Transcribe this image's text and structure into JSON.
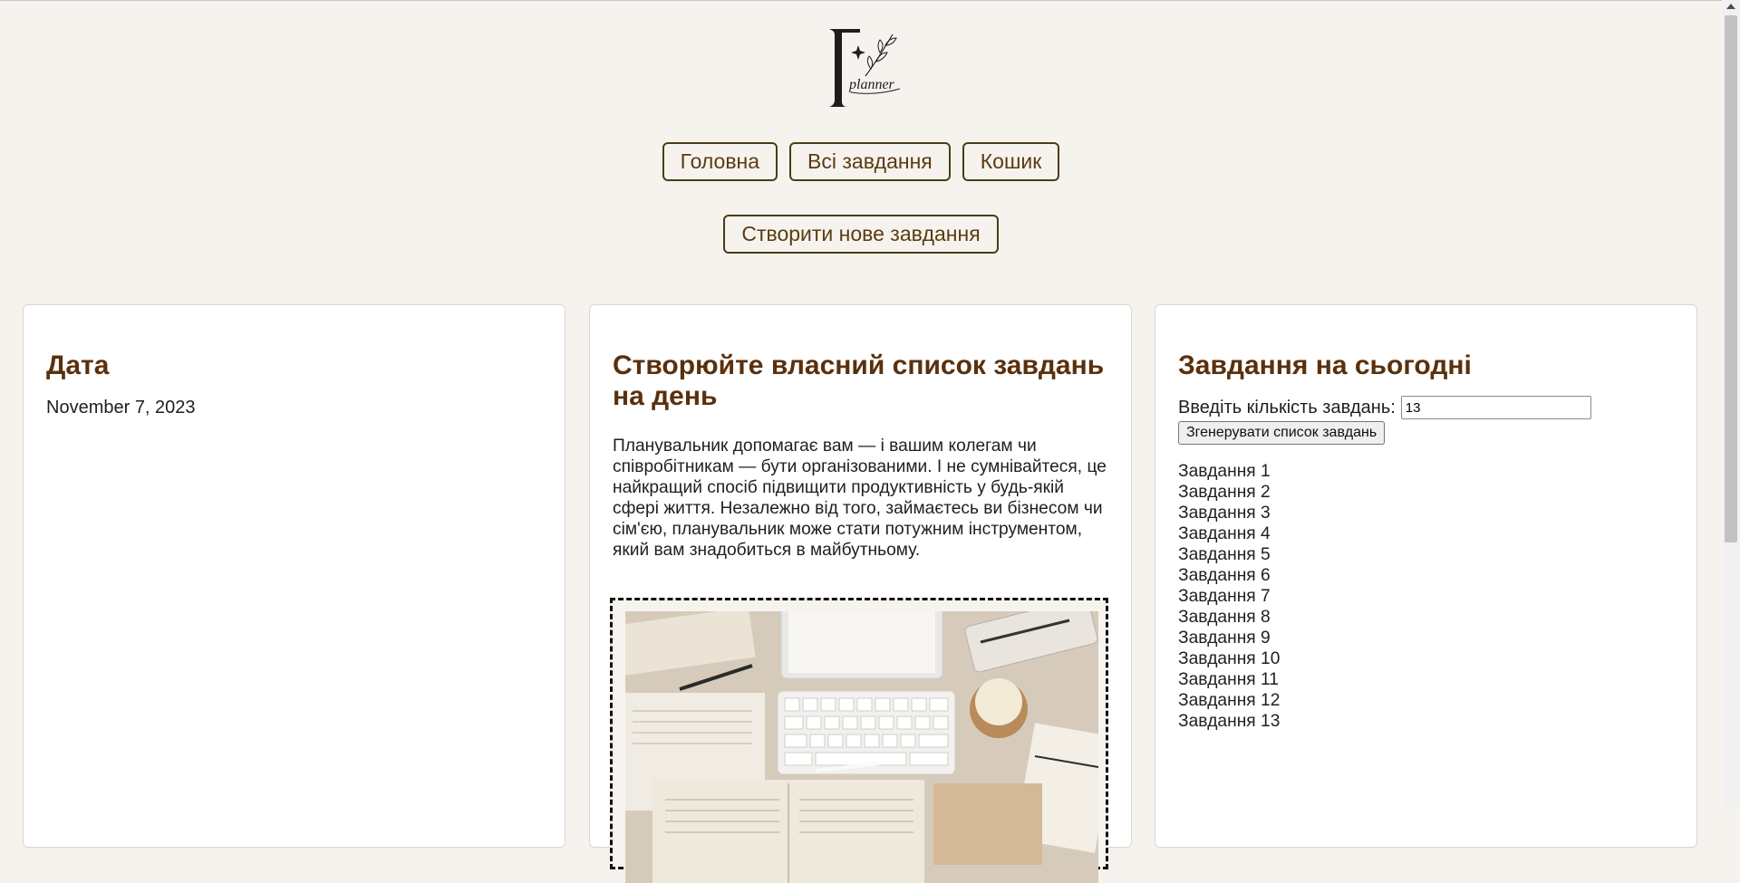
{
  "header": {
    "logo_text": "planner"
  },
  "nav": {
    "home": "Головна",
    "all_tasks": "Всі завдання",
    "trash": "Кошик"
  },
  "create_button": "Створити нове завдання",
  "date_card": {
    "title": "Дата",
    "date": "November 7, 2023"
  },
  "info_card": {
    "title": "Створюйте власний список завдань на день",
    "description": "Планувальник допомагає вам — і вашим колегам чи співробітникам — бути організованими. І не сумнівайтеся, це найкращий спосіб підвищити продуктивність у будь-якій сфері життя. Незалежно від того, займаєтесь ви бізнесом чи сім'єю, планувальник може стати потужним інструментом, який вам знадобиться в майбутньому."
  },
  "today_card": {
    "title": "Завдання на сьогодні",
    "count_label": "Введіть кількість завдань:",
    "count_value": "13",
    "generate_button": "Згенерувати список завдань",
    "tasks": [
      "Завдання 1",
      "Завдання 2",
      "Завдання 3",
      "Завдання 4",
      "Завдання 5",
      "Завдання 6",
      "Завдання 7",
      "Завдання 8",
      "Завдання 9",
      "Завдання 10",
      "Завдання 11",
      "Завдання 12",
      "Завдання 13"
    ]
  },
  "colors": {
    "background": "#f6f3ef",
    "heading": "#5a300d",
    "button_border": "#4a3d14",
    "button_text": "#5a3b10"
  }
}
